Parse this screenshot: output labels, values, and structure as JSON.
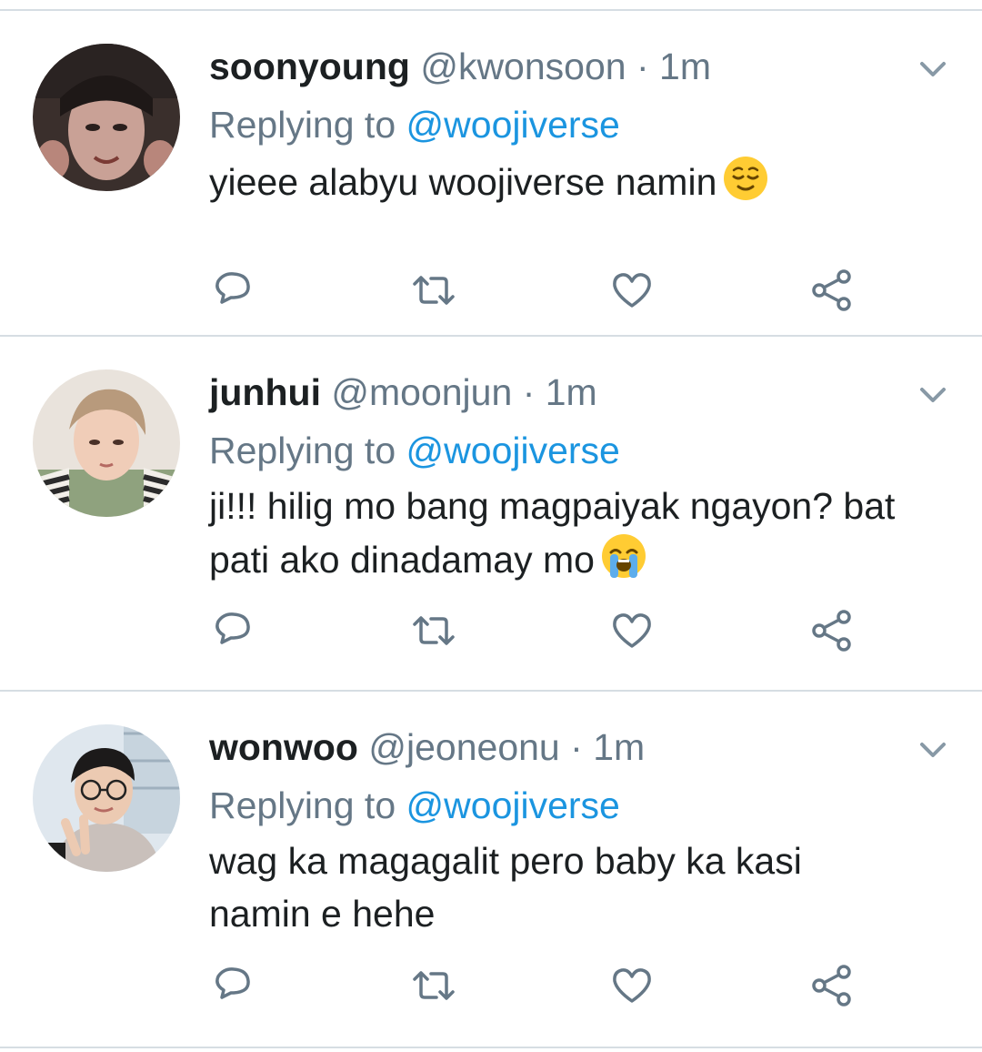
{
  "colors": {
    "text": "#1c2022",
    "secondary": "#657786",
    "link": "#1b95e0",
    "divider": "#d6dde3"
  },
  "icons": {
    "reply": "reply-icon",
    "retweet": "retweet-icon",
    "like": "heart-icon",
    "share": "share-icon",
    "more": "chevron-down-icon"
  },
  "tweets": [
    {
      "name": "soonyoung",
      "handle": "@kwonsoon",
      "separator": "·",
      "time": "1m",
      "replying_prefix": "Replying to",
      "replying_to": "@woojiverse",
      "text": "yieee alabyu woojiverse namin",
      "emoji": "relieved-face-emoji"
    },
    {
      "name": "junhui",
      "handle": "@moonjun",
      "separator": "·",
      "time": "1m",
      "replying_prefix": "Replying to",
      "replying_to": "@woojiverse",
      "text": "ji!!! hilig mo bang magpaiyak ngayon? bat pati ako dinadamay mo",
      "emoji": "loudly-crying-face-emoji"
    },
    {
      "name": "wonwoo",
      "handle": "@jeoneonu",
      "separator": "·",
      "time": "1m",
      "replying_prefix": "Replying to",
      "replying_to": "@woojiverse",
      "text": "wag ka magagalit pero baby ka kasi namin e hehe"
    }
  ]
}
